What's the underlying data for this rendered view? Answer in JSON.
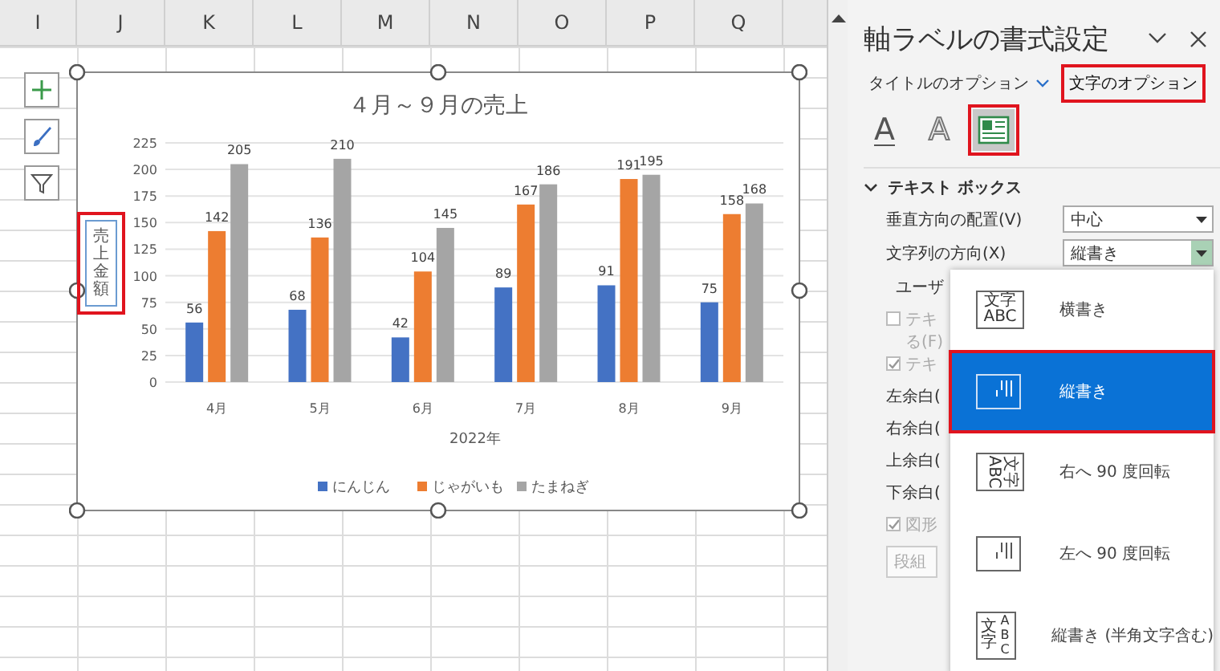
{
  "sheet": {
    "columns": [
      "I",
      "J",
      "K",
      "L",
      "M",
      "N",
      "O",
      "P",
      "Q"
    ],
    "chart_buttons": [
      {
        "kind": "plus"
      },
      {
        "kind": "brush"
      },
      {
        "kind": "filter"
      }
    ],
    "chart": {
      "axis_title_selected": true,
      "chart_data": {
        "type": "bar",
        "title": "４月～９月の売上",
        "xlabel": "2022年",
        "ylabel": "売上金額",
        "categories": [
          "4月",
          "5月",
          "6月",
          "7月",
          "8月",
          "9月"
        ],
        "series": [
          {
            "name": "にんじん",
            "color": "#4472c4",
            "values": [
              56,
              68,
              42,
              89,
              91,
              75
            ]
          },
          {
            "name": "じゃがいも",
            "color": "#ed7d31",
            "values": [
              142,
              136,
              104,
              167,
              191,
              158
            ]
          },
          {
            "name": "たまねぎ",
            "color": "#a5a5a5",
            "values": [
              205,
              210,
              145,
              186,
              195,
              168
            ]
          }
        ],
        "ylim": [
          0,
          225
        ],
        "yticks": [
          0,
          25,
          50,
          75,
          100,
          125,
          150,
          175,
          200,
          225
        ],
        "data_labels": true,
        "grid": true,
        "legend": true
      }
    }
  },
  "panel": {
    "title": "軸ラベルの書式設定",
    "tabs": [
      {
        "label": "タイトルのオプション",
        "selected": false,
        "has_menu": true
      },
      {
        "label": "文字のオプション",
        "selected": true,
        "has_menu": false
      }
    ],
    "icon_tabs": [
      {
        "kind": "fill",
        "glyph": "A",
        "selected": false
      },
      {
        "kind": "outline",
        "glyph": "A",
        "selected": false
      },
      {
        "kind": "textbox",
        "selected": true
      }
    ],
    "section": {
      "title": "テキスト ボックス",
      "expanded": true
    },
    "fields": [
      {
        "label": "垂直方向の配置(V)",
        "value": "中心",
        "open": false
      },
      {
        "label": "文字列の方向(X)",
        "value": "縦書き",
        "open": true
      }
    ],
    "hidden_rows": [
      {
        "kind": "heading",
        "text": "ユーザ"
      },
      {
        "kind": "checkbox",
        "text": "テキ",
        "text2": "る(F)",
        "disabled": true,
        "checked": false
      },
      {
        "kind": "checkbox",
        "text": "テキ",
        "disabled": true,
        "checked": true
      },
      {
        "kind": "label",
        "text": "左余白("
      },
      {
        "kind": "label",
        "text": "右余白("
      },
      {
        "kind": "label",
        "text": "上余白("
      },
      {
        "kind": "label",
        "text": "下余白("
      },
      {
        "kind": "checkbox",
        "text": "図形",
        "disabled": true,
        "checked": true
      },
      {
        "kind": "button",
        "text": "段組"
      }
    ],
    "menu": [
      {
        "label": "横書き",
        "selected": false,
        "kind": "horizontal",
        "icon_text": [
          "文字",
          "ABC"
        ]
      },
      {
        "label": "縦書き",
        "selected": true,
        "kind": "vertical"
      },
      {
        "label": "右へ 90 度回転",
        "selected": false,
        "kind": "rotate",
        "icon_text": [
          "文字",
          "ABC"
        ]
      },
      {
        "label": "左へ 90 度回転",
        "selected": false,
        "kind": "vertical"
      },
      {
        "label": "縦書き (半角文字含む)",
        "selected": false,
        "kind": "stacked",
        "icon_text": [
          "文字",
          "ABC"
        ]
      }
    ]
  }
}
